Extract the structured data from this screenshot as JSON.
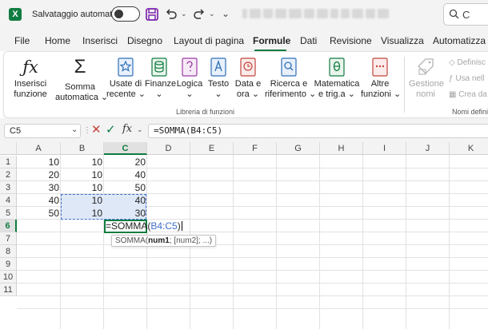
{
  "titlebar": {
    "app_icon": "X",
    "autosave_label": "Salvataggio automatico",
    "autosave_state": "off",
    "search_label": "C"
  },
  "menu": {
    "tabs": [
      {
        "label": "File"
      },
      {
        "label": "Home"
      },
      {
        "label": "Inserisci"
      },
      {
        "label": "Disegno"
      },
      {
        "label": "Layout di pagina"
      },
      {
        "label": "Formule",
        "active": true
      },
      {
        "label": "Dati"
      },
      {
        "label": "Revisione"
      },
      {
        "label": "Visualizza"
      },
      {
        "label": "Automatizza"
      }
    ]
  },
  "ribbon": {
    "insert_function": {
      "line1": "Inserisci",
      "line2": "funzione"
    },
    "autosum": {
      "line1": "Somma",
      "line2": "automatica"
    },
    "recent": {
      "line1": "Usate di",
      "line2": "recente"
    },
    "finance": {
      "line1": "Finanze"
    },
    "logical": {
      "line1": "Logica"
    },
    "text": {
      "line1": "Testo"
    },
    "datetime": {
      "line1": "Data e",
      "line2": "ora"
    },
    "lookup": {
      "line1": "Ricerca e",
      "line2": "riferimento"
    },
    "math": {
      "line1": "Matematica",
      "line2": "e trig.a"
    },
    "more": {
      "line1": "Altre",
      "line2": "funzioni"
    },
    "library_label": "Libreria di funzioni",
    "name_manager": {
      "line1": "Gestione",
      "line2": "nomi"
    },
    "define": "Definisc",
    "use_in": "Usa nell",
    "create_from": "Crea da",
    "defined_names_label": "Nomi defini"
  },
  "formula_bar": {
    "name_box": "C5",
    "formula": "=SOMMA(B4:C5)",
    "fx_label": "fx"
  },
  "grid": {
    "columns": [
      "A",
      "B",
      "C",
      "D",
      "E",
      "F",
      "G",
      "H",
      "I",
      "J",
      "K"
    ],
    "rows": [
      "1",
      "2",
      "3",
      "4",
      "5",
      "6",
      "7",
      "8",
      "9",
      "10",
      "11"
    ],
    "colA": [
      "10",
      "20",
      "30",
      "40",
      "50"
    ],
    "colB": [
      "10",
      "10",
      "10",
      "10",
      "10"
    ],
    "colC": [
      "20",
      "40",
      "50",
      "40",
      "30"
    ],
    "edit_prefix": "=SOMMA(",
    "edit_ref": "B4:C5",
    "edit_suffix": ")",
    "tooltip_fn": "SOMMA(",
    "tooltip_arg": "num1",
    "tooltip_rest": "; [num2]; ...)"
  }
}
